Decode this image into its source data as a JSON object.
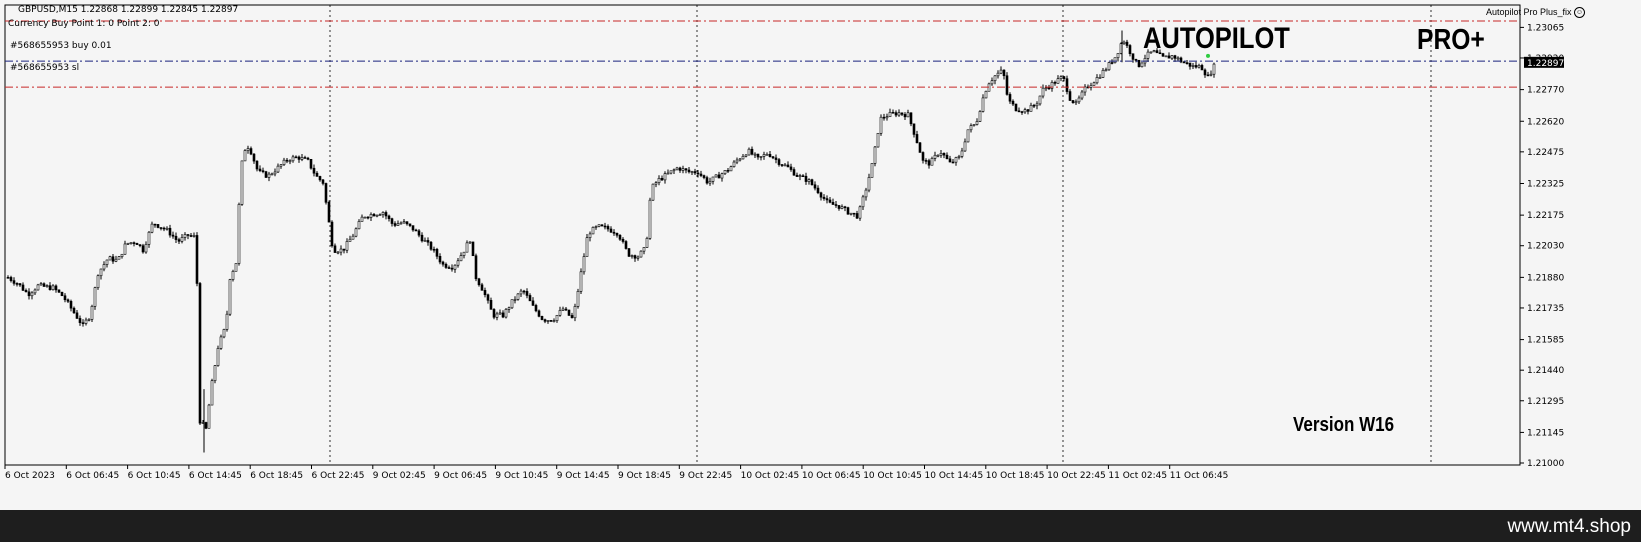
{
  "chart_header": {
    "symbol_line": "GBPUSD,M15  1.22868 1.22899 1.22845 1.22897",
    "currency_line": "Currency Buy Point 1: 0 Point 2: 0"
  },
  "indicator_name": "Autopilot Pro Plus_fix",
  "brand": {
    "autopilot": "AUTOPILOT",
    "pro": "PRO+",
    "version": "Version W16"
  },
  "order_lines": [
    {
      "label": "#568655953 buy 0.01",
      "price": 1.22905,
      "color": "#1a237e"
    },
    {
      "label": "#568655953 sl",
      "price": 1.22782,
      "color": "#c62828"
    }
  ],
  "top_line": {
    "price": 1.23095,
    "color": "#c62828"
  },
  "current_price": "1.22897",
  "footer": {
    "site": "www.mt4.shop"
  },
  "chart_data": {
    "type": "candlestick",
    "symbol": "GBPUSD",
    "timeframe": "M15",
    "y_axis": {
      "min": 1.21,
      "max": 1.231,
      "ticks": [
        "1.23065",
        "1.22920",
        "1.22770",
        "1.22620",
        "1.22475",
        "1.22325",
        "1.22175",
        "1.22030",
        "1.21880",
        "1.21735",
        "1.21585",
        "1.21440",
        "1.21295",
        "1.21145",
        "1.21000"
      ]
    },
    "x_axis": {
      "ticks": [
        "6 Oct 2023",
        "6 Oct 06:45",
        "6 Oct 10:45",
        "6 Oct 14:45",
        "6 Oct 18:45",
        "6 Oct 22:45",
        "9 Oct 02:45",
        "9 Oct 06:45",
        "9 Oct 10:45",
        "9 Oct 14:45",
        "9 Oct 18:45",
        "9 Oct 22:45",
        "10 Oct 02:45",
        "10 Oct 06:45",
        "10 Oct 10:45",
        "10 Oct 14:45",
        "10 Oct 18:45",
        "10 Oct 22:45",
        "11 Oct 02:45",
        "11 Oct 06:45"
      ],
      "separators": [
        "6 Oct 22:45",
        "9 Oct 22:45",
        "10 Oct 22:45"
      ]
    },
    "close_path": [
      [
        0,
        1.2188
      ],
      [
        10,
        1.2185
      ],
      [
        20,
        1.218
      ],
      [
        30,
        1.2184
      ],
      [
        45,
        1.2183
      ],
      [
        55,
        1.2179
      ],
      [
        65,
        1.2172
      ],
      [
        75,
        1.2165
      ],
      [
        82,
        1.217
      ],
      [
        90,
        1.219
      ],
      [
        100,
        1.2197
      ],
      [
        110,
        1.2196
      ],
      [
        118,
        1.2204
      ],
      [
        128,
        1.2205
      ],
      [
        135,
        1.2201
      ],
      [
        145,
        1.2214
      ],
      [
        160,
        1.221
      ],
      [
        170,
        1.2205
      ],
      [
        180,
        1.2208
      ],
      [
        188,
        1.2207
      ],
      [
        192,
        1.212
      ],
      [
        198,
        1.2116
      ],
      [
        203,
        1.2135
      ],
      [
        210,
        1.2155
      ],
      [
        218,
        1.2165
      ],
      [
        222,
        1.2188
      ],
      [
        228,
        1.2195
      ],
      [
        233,
        1.224
      ],
      [
        238,
        1.2251
      ],
      [
        242,
        1.2249
      ],
      [
        250,
        1.2238
      ],
      [
        260,
        1.2236
      ],
      [
        270,
        1.224
      ],
      [
        280,
        1.2244
      ],
      [
        290,
        1.2245
      ],
      [
        300,
        1.2243
      ],
      [
        308,
        1.2236
      ],
      [
        315,
        1.2233
      ],
      [
        325,
        1.2201
      ],
      [
        335,
        1.2201
      ],
      [
        345,
        1.2208
      ],
      [
        355,
        1.2217
      ],
      [
        365,
        1.2218
      ],
      [
        375,
        1.2219
      ],
      [
        385,
        1.2213
      ],
      [
        395,
        1.2214
      ],
      [
        405,
        1.2211
      ],
      [
        415,
        1.2206
      ],
      [
        425,
        1.2201
      ],
      [
        435,
        1.2194
      ],
      [
        445,
        1.2193
      ],
      [
        455,
        1.22
      ],
      [
        462,
        1.2206
      ],
      [
        468,
        1.2188
      ],
      [
        475,
        1.2182
      ],
      [
        485,
        1.217
      ],
      [
        495,
        1.217
      ],
      [
        505,
        1.2177
      ],
      [
        515,
        1.2182
      ],
      [
        525,
        1.2174
      ],
      [
        535,
        1.2168
      ],
      [
        545,
        1.2168
      ],
      [
        555,
        1.2173
      ],
      [
        565,
        1.2168
      ],
      [
        573,
        1.219
      ],
      [
        580,
        1.2209
      ],
      [
        590,
        1.2212
      ],
      [
        600,
        1.2211
      ],
      [
        610,
        1.2209
      ],
      [
        620,
        1.2199
      ],
      [
        630,
        1.2198
      ],
      [
        638,
        1.2202
      ],
      [
        643,
        1.223
      ],
      [
        650,
        1.2234
      ],
      [
        660,
        1.2237
      ],
      [
        670,
        1.224
      ],
      [
        680,
        1.2238
      ],
      [
        690,
        1.2238
      ],
      [
        700,
        1.2233
      ],
      [
        710,
        1.2236
      ],
      [
        720,
        1.2239
      ],
      [
        730,
        1.2244
      ],
      [
        740,
        1.2248
      ],
      [
        750,
        1.2244
      ],
      [
        760,
        1.2247
      ],
      [
        770,
        1.2243
      ],
      [
        780,
        1.224
      ],
      [
        790,
        1.2236
      ],
      [
        800,
        1.2234
      ],
      [
        810,
        1.2229
      ],
      [
        820,
        1.2223
      ],
      [
        830,
        1.2222
      ],
      [
        840,
        1.2219
      ],
      [
        850,
        1.2217
      ],
      [
        858,
        1.223
      ],
      [
        865,
        1.2243
      ],
      [
        872,
        1.2263
      ],
      [
        880,
        1.2265
      ],
      [
        890,
        1.2266
      ],
      [
        900,
        1.2265
      ],
      [
        908,
        1.2254
      ],
      [
        915,
        1.2243
      ],
      [
        922,
        1.2242
      ],
      [
        932,
        1.2248
      ],
      [
        942,
        1.2242
      ],
      [
        952,
        1.2245
      ],
      [
        960,
        1.2258
      ],
      [
        968,
        1.2261
      ],
      [
        975,
        1.2273
      ],
      [
        980,
        1.228
      ],
      [
        988,
        1.2284
      ],
      [
        995,
        1.2286
      ],
      [
        1000,
        1.2272
      ],
      [
        1008,
        1.2268
      ],
      [
        1018,
        1.2267
      ],
      [
        1028,
        1.227
      ],
      [
        1035,
        1.2277
      ],
      [
        1045,
        1.228
      ],
      [
        1055,
        1.2283
      ],
      [
        1062,
        1.2273
      ],
      [
        1068,
        1.227
      ],
      [
        1078,
        1.2278
      ],
      [
        1088,
        1.2282
      ],
      [
        1098,
        1.2287
      ],
      [
        1108,
        1.2293
      ],
      [
        1115,
        1.2301
      ],
      [
        1122,
        1.2295
      ],
      [
        1130,
        1.2288
      ],
      [
        1138,
        1.2293
      ],
      [
        1145,
        1.2295
      ],
      [
        1155,
        1.2292
      ],
      [
        1165,
        1.2293
      ],
      [
        1175,
        1.229
      ],
      [
        1185,
        1.2288
      ],
      [
        1193,
        1.2288
      ],
      [
        1200,
        1.2283
      ],
      [
        1208,
        1.22897
      ]
    ]
  }
}
